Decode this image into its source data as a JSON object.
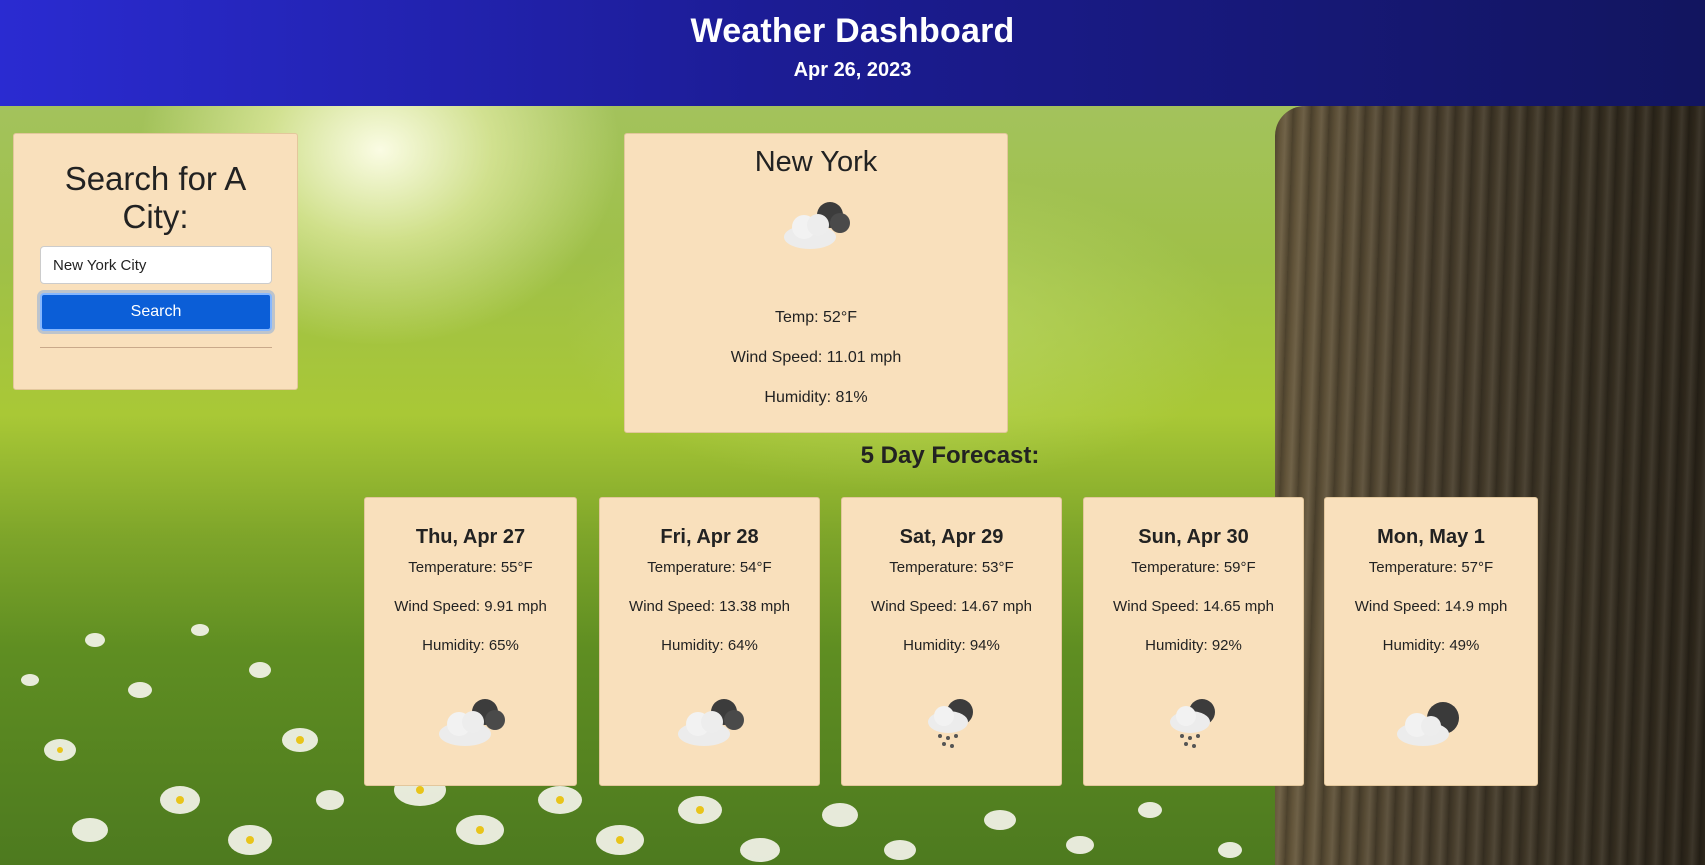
{
  "header": {
    "title": "Weather Dashboard",
    "date": "Apr 26, 2023"
  },
  "search": {
    "heading": "Search for A City:",
    "input_value": "New York City",
    "button_label": "Search"
  },
  "current": {
    "city": "New York",
    "icon": "cloud-night-icon",
    "temp": "Temp: 52°F",
    "wind": "Wind Speed: 11.01 mph",
    "humidity": "Humidity: 81%"
  },
  "forecast": {
    "title": "5 Day Forecast:",
    "days": [
      {
        "date": "Thu, Apr 27",
        "temp": "Temperature: 55°F",
        "wind": "Wind Speed: 9.91 mph",
        "humidity": "Humidity: 65%",
        "icon": "cloud-night-icon"
      },
      {
        "date": "Fri, Apr 28",
        "temp": "Temperature: 54°F",
        "wind": "Wind Speed: 13.38 mph",
        "humidity": "Humidity: 64%",
        "icon": "cloud-night-icon"
      },
      {
        "date": "Sat, Apr 29",
        "temp": "Temperature: 53°F",
        "wind": "Wind Speed: 14.67 mph",
        "humidity": "Humidity: 94%",
        "icon": "rain-night-icon"
      },
      {
        "date": "Sun, Apr 30",
        "temp": "Temperature: 59°F",
        "wind": "Wind Speed: 14.65 mph",
        "humidity": "Humidity: 92%",
        "icon": "rain-night-icon"
      },
      {
        "date": "Mon, May 1",
        "temp": "Temperature: 57°F",
        "wind": "Wind Speed: 14.9 mph",
        "humidity": "Humidity: 49%",
        "icon": "cloud-moon-icon"
      }
    ]
  },
  "colors": {
    "header_start": "#2a2bd1",
    "header_end": "#12155f",
    "card_bg": "#f9e0bc",
    "button": "#0b5ed7"
  }
}
